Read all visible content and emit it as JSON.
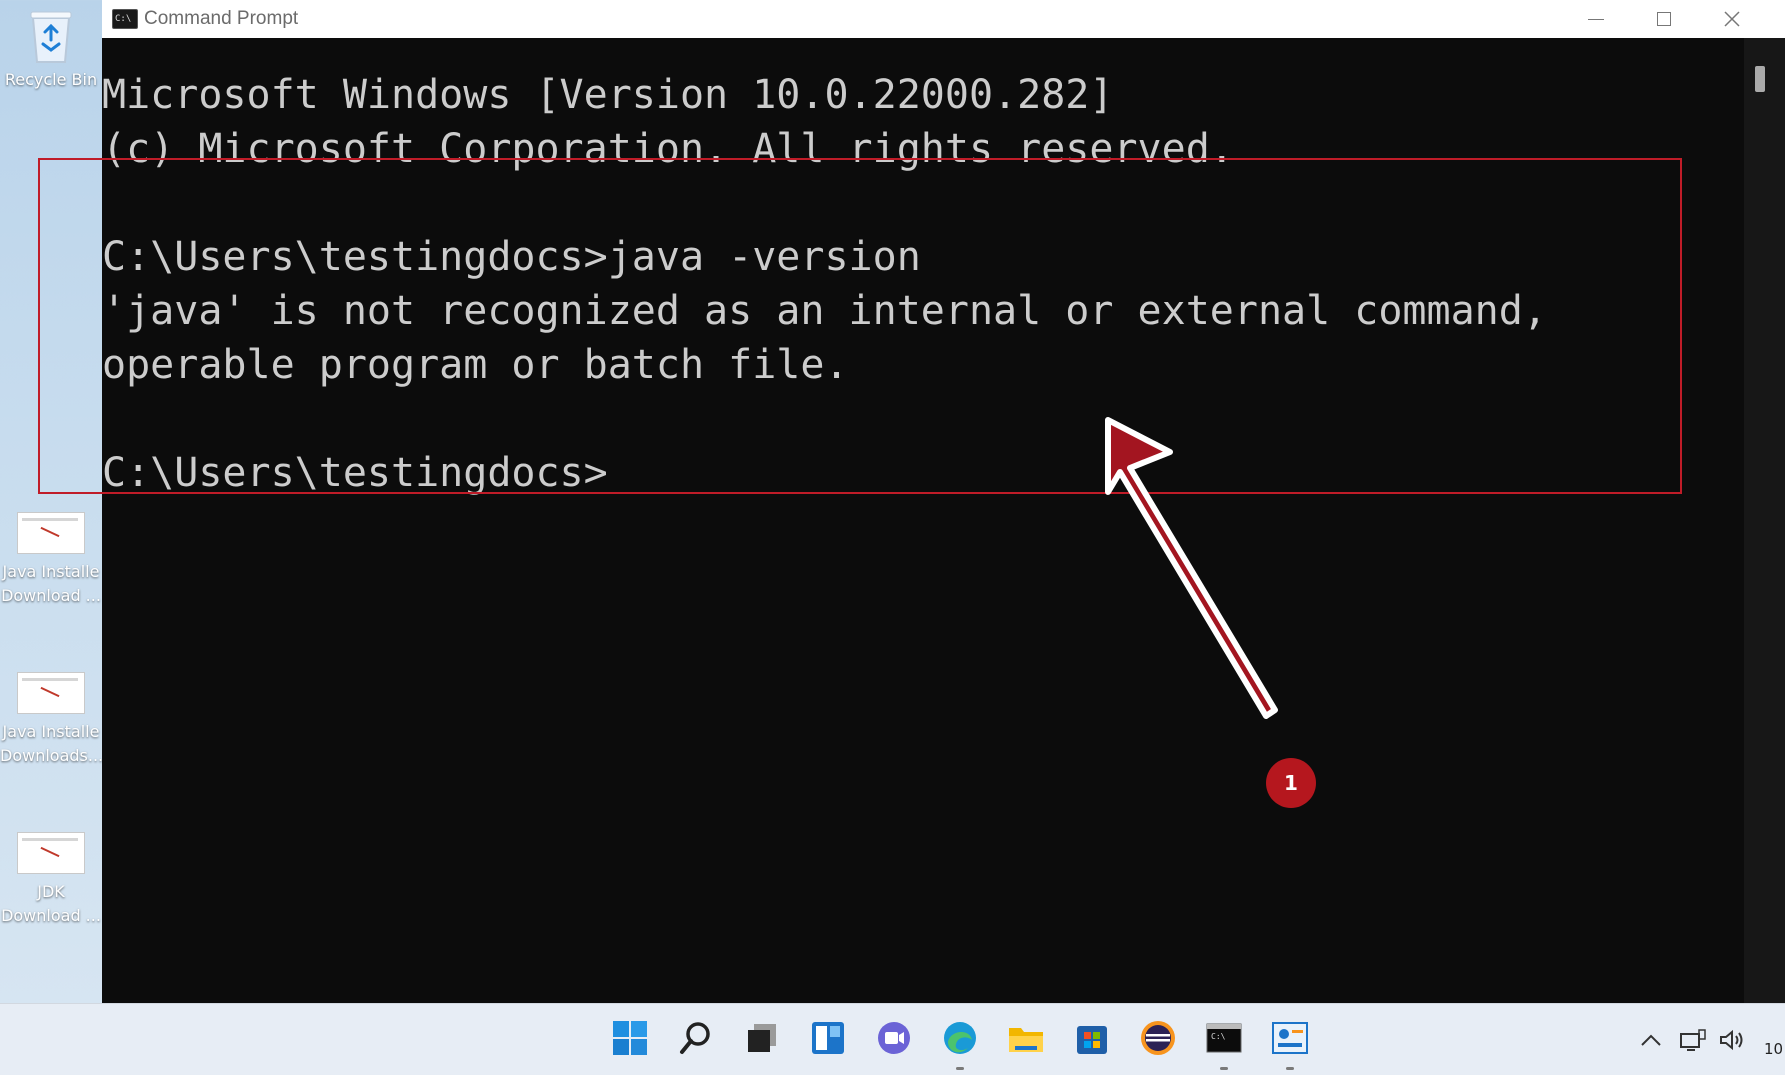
{
  "desktop": {
    "recycle_bin": {
      "label": "Recycle Bin"
    },
    "icons": [
      {
        "line1": "Java Installe",
        "line2": "Download ..."
      },
      {
        "line1": "Java Installe",
        "line2": "Downloads..."
      },
      {
        "line1": "JDK",
        "line2": "Download ..."
      }
    ]
  },
  "window": {
    "title": "Command Prompt",
    "icon": "cmd-icon",
    "title_icon_text": "C:\\",
    "controls": [
      "minimize-icon",
      "maximize-icon",
      "close-icon"
    ]
  },
  "console": {
    "lines": [
      "Microsoft Windows [Version 10.0.22000.282]",
      "(c) Microsoft Corporation. All rights reserved.",
      "",
      "C:\\Users\\testingdocs>java -version",
      "'java' is not recognized as an internal or external command,",
      "operable program or batch file.",
      "",
      "C:\\Users\\testingdocs>"
    ]
  },
  "annotation": {
    "badge": "1",
    "color": "#c01c28"
  },
  "taskbar": {
    "icons": [
      "windows-start-icon",
      "search-icon",
      "task-view-icon",
      "widgets-icon",
      "chat-icon",
      "edge-icon",
      "file-explorer-icon",
      "store-icon",
      "eclipse-icon",
      "terminal-icon",
      "app-icon"
    ],
    "tray_icons": [
      "chevron-up-icon",
      "network-icon",
      "volume-icon"
    ],
    "clock": "10"
  }
}
